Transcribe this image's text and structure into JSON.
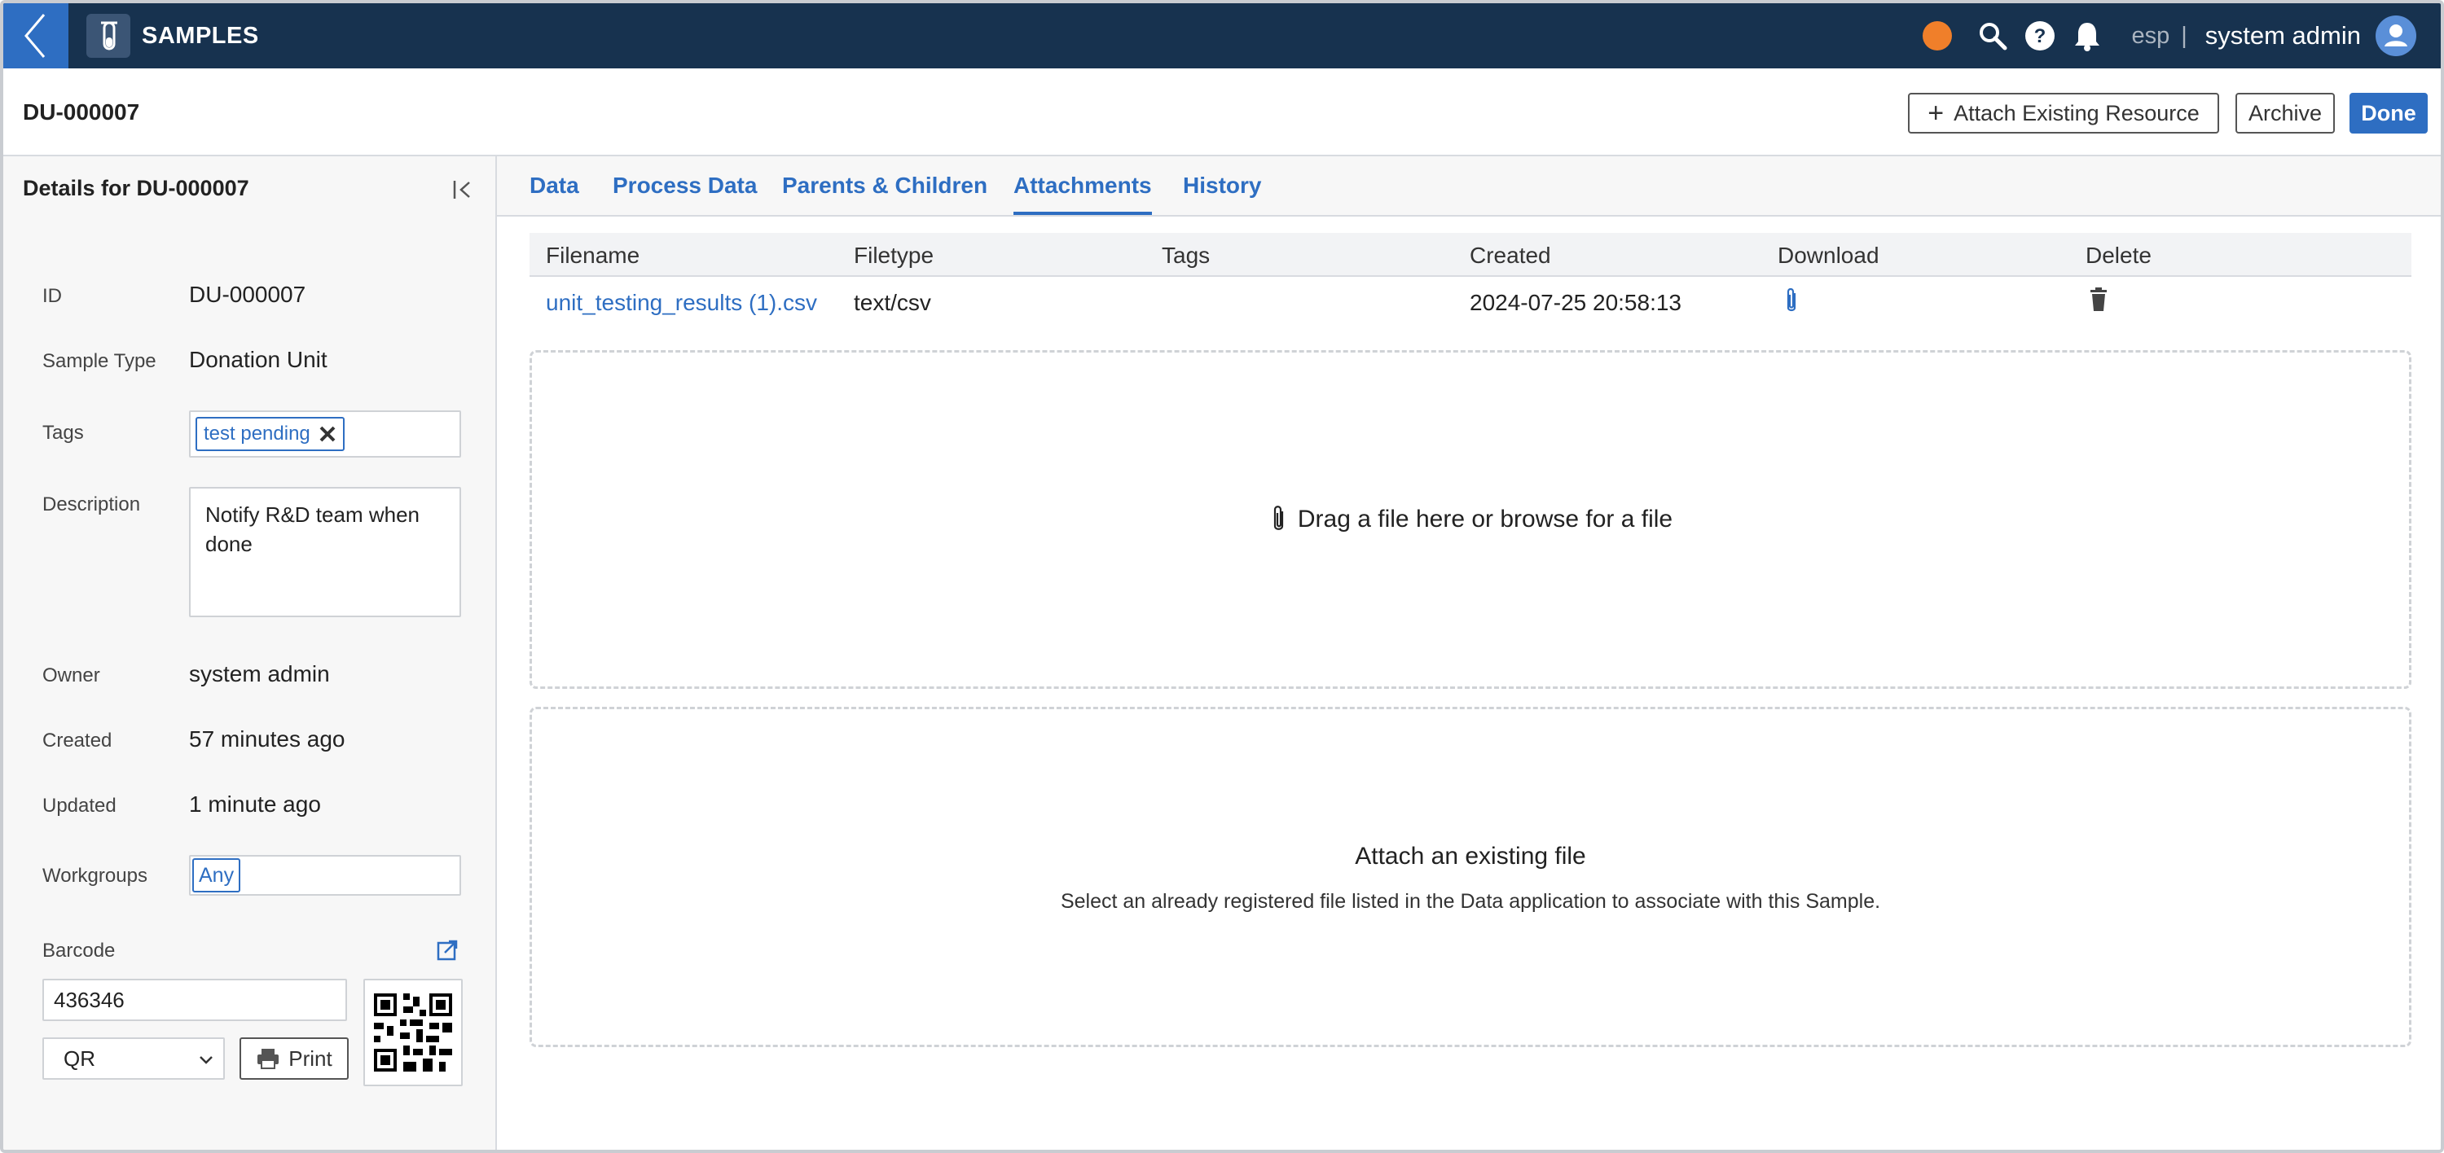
{
  "app": {
    "title": "SAMPLES",
    "lab": "esp",
    "separator": "|",
    "user": "system admin",
    "status_color": "#f07f2a",
    "accent": "#2e6ec2",
    "nav_bg": "#17324f"
  },
  "header": {
    "title": "DU-000007",
    "attach_label": "Attach Existing Resource",
    "archive_label": "Archive",
    "done_label": "Done"
  },
  "details": {
    "title": "Details for DU-000007",
    "id_label": "ID",
    "id_value": "DU-000007",
    "sample_type_label": "Sample Type",
    "sample_type_value": "Donation Unit",
    "tags_label": "Tags",
    "tags": [
      "test pending"
    ],
    "description_label": "Description",
    "description_value": "Notify R&D team when done",
    "owner_label": "Owner",
    "owner_value": "system admin",
    "created_label": "Created",
    "created_value": "57 minutes ago",
    "updated_label": "Updated",
    "updated_value": "1 minute ago",
    "workgroups_label": "Workgroups",
    "workgroups": [
      "Any"
    ],
    "barcode_label": "Barcode",
    "barcode_value": "436346",
    "barcode_type": "QR",
    "print_label": "Print"
  },
  "tabs": [
    {
      "label": "Data",
      "active": false
    },
    {
      "label": "Process Data",
      "active": false
    },
    {
      "label": "Parents & Children",
      "active": false
    },
    {
      "label": "Attachments",
      "active": true
    },
    {
      "label": "History",
      "active": false
    }
  ],
  "attachments": {
    "columns": [
      "Filename",
      "Filetype",
      "Tags",
      "Created",
      "Download",
      "Delete"
    ],
    "rows": [
      {
        "filename": "unit_testing_results (1).csv",
        "filetype": "text/csv",
        "tags": "",
        "created": "2024-07-25 20:58:13"
      }
    ],
    "dropzone_text": "Drag a file here or browse for a file",
    "existing_title": "Attach an existing file",
    "existing_subtitle": "Select an already registered file listed in the Data application to associate with this Sample."
  },
  "icons": {
    "back": "chevron-left-icon",
    "app": "test-tube-icon",
    "search": "search-icon",
    "help": "help-icon",
    "notifications": "bell-icon",
    "user": "user-icon",
    "collapse": "collapse-left-icon",
    "external": "external-link-icon",
    "download": "paperclip-icon",
    "delete": "trash-icon",
    "print": "printer-icon"
  }
}
